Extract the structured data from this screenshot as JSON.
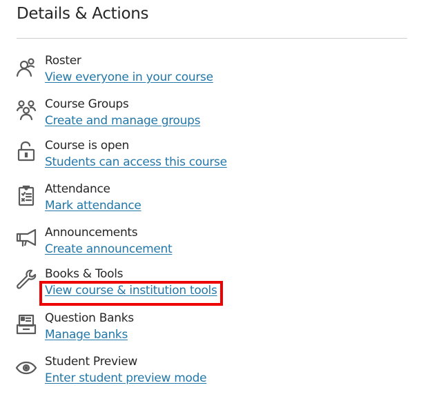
{
  "header": {
    "title": "Details & Actions"
  },
  "items": [
    {
      "icon": "roster-icon",
      "label": "Roster",
      "link": "View everyone in your course"
    },
    {
      "icon": "groups-icon",
      "label": "Course Groups",
      "link": "Create and manage groups"
    },
    {
      "icon": "unlocked-icon",
      "label": "Course is open",
      "link": "Students can access this course"
    },
    {
      "icon": "attendance-clipboard-icon",
      "label": "Attendance",
      "link": "Mark attendance"
    },
    {
      "icon": "megaphone-icon",
      "label": "Announcements",
      "link": "Create announcement"
    },
    {
      "icon": "wrench-icon",
      "label": "Books & Tools",
      "link": "View course & institution tools"
    },
    {
      "icon": "question-bank-icon",
      "label": "Question Banks",
      "link": "Manage banks"
    },
    {
      "icon": "eye-icon",
      "label": "Student Preview",
      "link": "Enter student preview mode"
    }
  ],
  "highlight": {
    "target": "View course & institution tools",
    "color": "#ee0000"
  },
  "colors": {
    "link": "#2277a9",
    "text": "#262626",
    "icon": "#595959"
  }
}
